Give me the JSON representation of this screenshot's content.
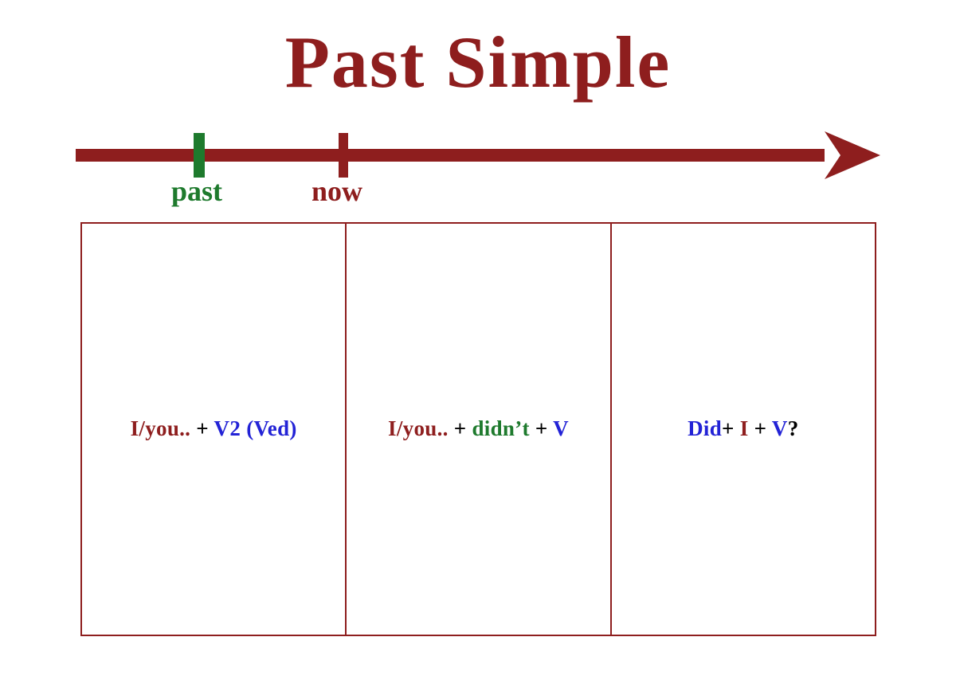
{
  "title": "Past Simple",
  "timeline": {
    "past_label": "past",
    "now_label": "now"
  },
  "colors": {
    "red": "#8e1e1e",
    "blue": "#2323d6",
    "green": "#1e7a2d",
    "black": "#000000"
  },
  "cells": {
    "affirmative": {
      "part1_text": "I/you.. ",
      "part1_color": "red",
      "plus1": "+ ",
      "plus1_color": "black",
      "part2_text": "V2 (Ved)",
      "part2_color": "blue"
    },
    "negative": {
      "part1_text": "I/you.. ",
      "part1_color": "red",
      "plus1": "+ ",
      "plus1_color": "black",
      "part2_text": "didn’t ",
      "part2_color": "green",
      "plus2": "+  ",
      "plus2_color": "black",
      "part3_text": "V",
      "part3_color": "blue"
    },
    "question": {
      "part1_text": "Did",
      "part1_color": "blue",
      "plus1": "+ ",
      "plus1_color": "black",
      "part2_text": "I ",
      "part2_color": "red",
      "plus2": "+ ",
      "plus2_color": "black",
      "part3_text": "V",
      "part3_color": "blue",
      "qmark": "?",
      "qmark_color": "black"
    }
  }
}
